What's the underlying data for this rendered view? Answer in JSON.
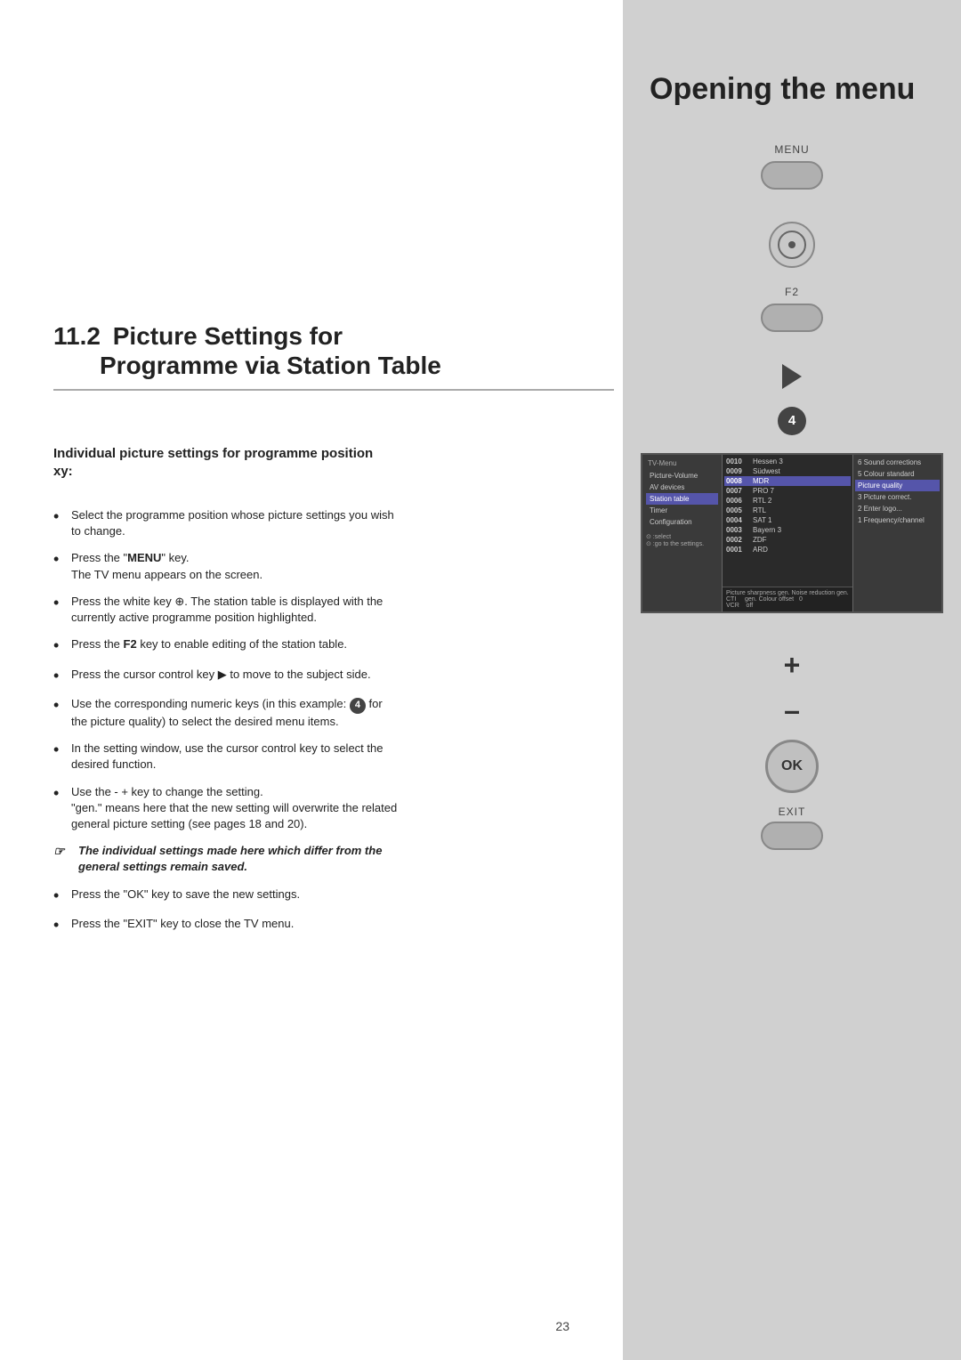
{
  "page": {
    "number": "23",
    "background": "#ffffff"
  },
  "section": {
    "number": "11.2",
    "title_line1": "Picture Settings for",
    "title_line2": "Programme via Station Table",
    "right_heading": "Opening the menu"
  },
  "subheading": {
    "text": "Individual picture settings for programme position xy:"
  },
  "bullets": [
    {
      "id": 1,
      "text": "Select the programme position whose picture settings you wish to change."
    },
    {
      "id": 2,
      "prefix": "Press the \"",
      "bold": "MENU",
      "suffix": "\" key.\nThe TV menu appears on the screen."
    },
    {
      "id": 3,
      "text": "Press the white key ⊕. The station table is displayed with the currently active programme position highlighted."
    },
    {
      "id": 4,
      "prefix": "Press the ",
      "bold": "F2",
      "suffix": " key to enable editing of the station table."
    },
    {
      "id": 5,
      "prefix": "Press the cursor control key ▶ to move to the subject side."
    },
    {
      "id": 6,
      "text": "Use the corresponding numeric keys (in this example: ④ for the picture quality) to select the desired menu items."
    },
    {
      "id": 7,
      "text": "In the setting window, use the cursor control key to select the desired function."
    },
    {
      "id": 8,
      "prefix": "Use the - + key to change the setting. \"gen.\" means here that the new setting will overwrite the related general picture setting (see pages 18 and 20)."
    }
  ],
  "note": {
    "icon": "☞",
    "text_italic": "The individual settings made here which differ from the general settings remain saved."
  },
  "bullets_end": [
    {
      "id": 9,
      "text": "Press the \"OK\" key to save the new settings."
    },
    {
      "id": 10,
      "text": "Press the \"EXIT\" key to close the TV menu."
    }
  ],
  "remote": {
    "menu_label": "MENU",
    "f2_label": "F2",
    "ok_label": "OK",
    "exit_label": "EXIT",
    "plus_symbol": "+",
    "minus_symbol": "–"
  },
  "tv_screen": {
    "channels": [
      {
        "num": "0010",
        "name": "Hessen 3"
      },
      {
        "num": "0009",
        "name": "Südwest"
      },
      {
        "num": "0008",
        "name": "MDR",
        "highlight": true
      },
      {
        "num": "0007",
        "name": "PRO 7"
      },
      {
        "num": "0006",
        "name": "RTL 2"
      },
      {
        "num": "0005",
        "name": "RTL"
      },
      {
        "num": "0004",
        "name": "SAT 1"
      },
      {
        "num": "0003",
        "name": "Bayern 3"
      },
      {
        "num": "0002",
        "name": "ZDF"
      },
      {
        "num": "0001",
        "name": "ARD"
      }
    ],
    "left_menu": [
      {
        "label": "TV-Menu",
        "items": [
          "Picture-Volume",
          "AV devices",
          "Station table",
          "Timer",
          "Configuration"
        ]
      },
      {
        "label": "select",
        "items": [
          "go to the settings."
        ]
      }
    ],
    "right_menu": [
      {
        "label": "6 Sound corrections",
        "active": false
      },
      {
        "label": "5 Colour standard",
        "active": false
      },
      {
        "label": "Picture quality",
        "active": true
      },
      {
        "label": "3 Picture correct.",
        "active": false
      },
      {
        "label": "2 Enter logo...",
        "active": false
      },
      {
        "label": "1 Frequency/channel",
        "active": false
      }
    ],
    "bottom_bar": "Picture sharpness gen. Noise reduction gen. CTI gen. Colour offset 0 VCR off"
  }
}
